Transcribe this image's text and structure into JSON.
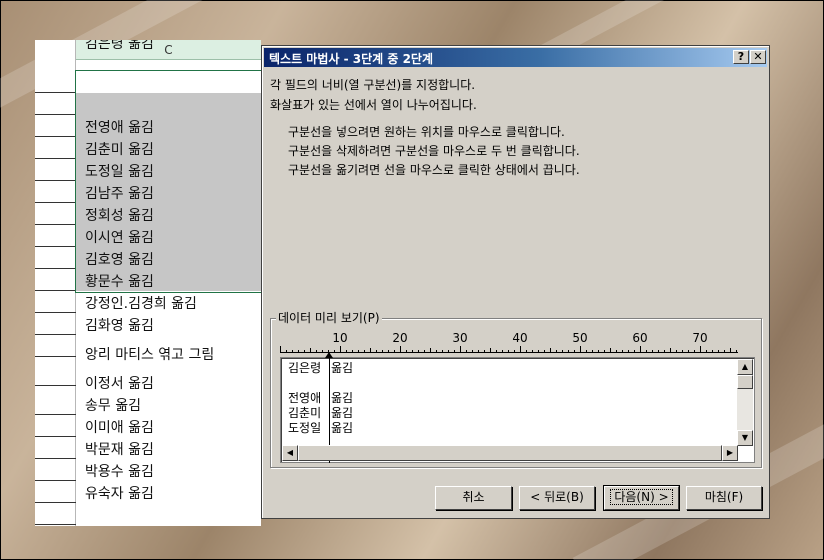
{
  "sheet": {
    "column_header": "C",
    "cells": [
      "김은령 옮김",
      "",
      "전영애 옮김",
      "김춘미 옮김",
      "도정일 옮김",
      "김남주 옮김",
      "정회성 옮김",
      "이시연 옮김",
      "김호영 옮김",
      "황문수 옮김",
      "강정인.김경희 옮김",
      "김화영 옮김",
      "앙리 마티스 엮고 그림",
      "이정서 옮김",
      "송무 옮김",
      "이미애 옮김",
      "박문재 옮김",
      "박용수 옮김",
      "유숙자 옮김"
    ]
  },
  "dialog": {
    "title": "텍스트 마법사 - 3단계 중 2단계",
    "help_label": "?",
    "close_label": "✕",
    "intro_line1": "각 필드의 너비(열 구분선)를 지정합니다.",
    "intro_line2": "화살표가 있는 선에서 열이 나누어집니다.",
    "instr_line1": "구분선을 넣으려면 원하는 위치를 마우스로 클릭합니다.",
    "instr_line2": "구분선을 삭제하려면 구분선을 마우스로 두 번 클릭합니다.",
    "instr_line3": "구분선을 옮기려면 선을 마우스로 클릭한 상태에서 끕니다.",
    "preview_group_label": "데이터 미리 보기(P)",
    "ruler_labels": [
      "10",
      "20",
      "30",
      "40",
      "50",
      "60",
      "70"
    ],
    "preview_rows": [
      [
        "김은령",
        "옮김"
      ],
      [
        "",
        ""
      ],
      [
        "전영애",
        "옮김"
      ],
      [
        "김춘미",
        "옮김"
      ],
      [
        "도정일",
        "옮김"
      ]
    ],
    "buttons": {
      "cancel": "취소",
      "back": "< 뒤로(B)",
      "next": "다음(N) >",
      "finish": "마침(F)"
    }
  },
  "colors": {
    "title_bar_start": "#0a246a",
    "title_bar_end": "#a6caf0",
    "dialog_face": "#d4d0c8",
    "selection_border": "#217346",
    "selection_fill": "#c6c6c6"
  }
}
